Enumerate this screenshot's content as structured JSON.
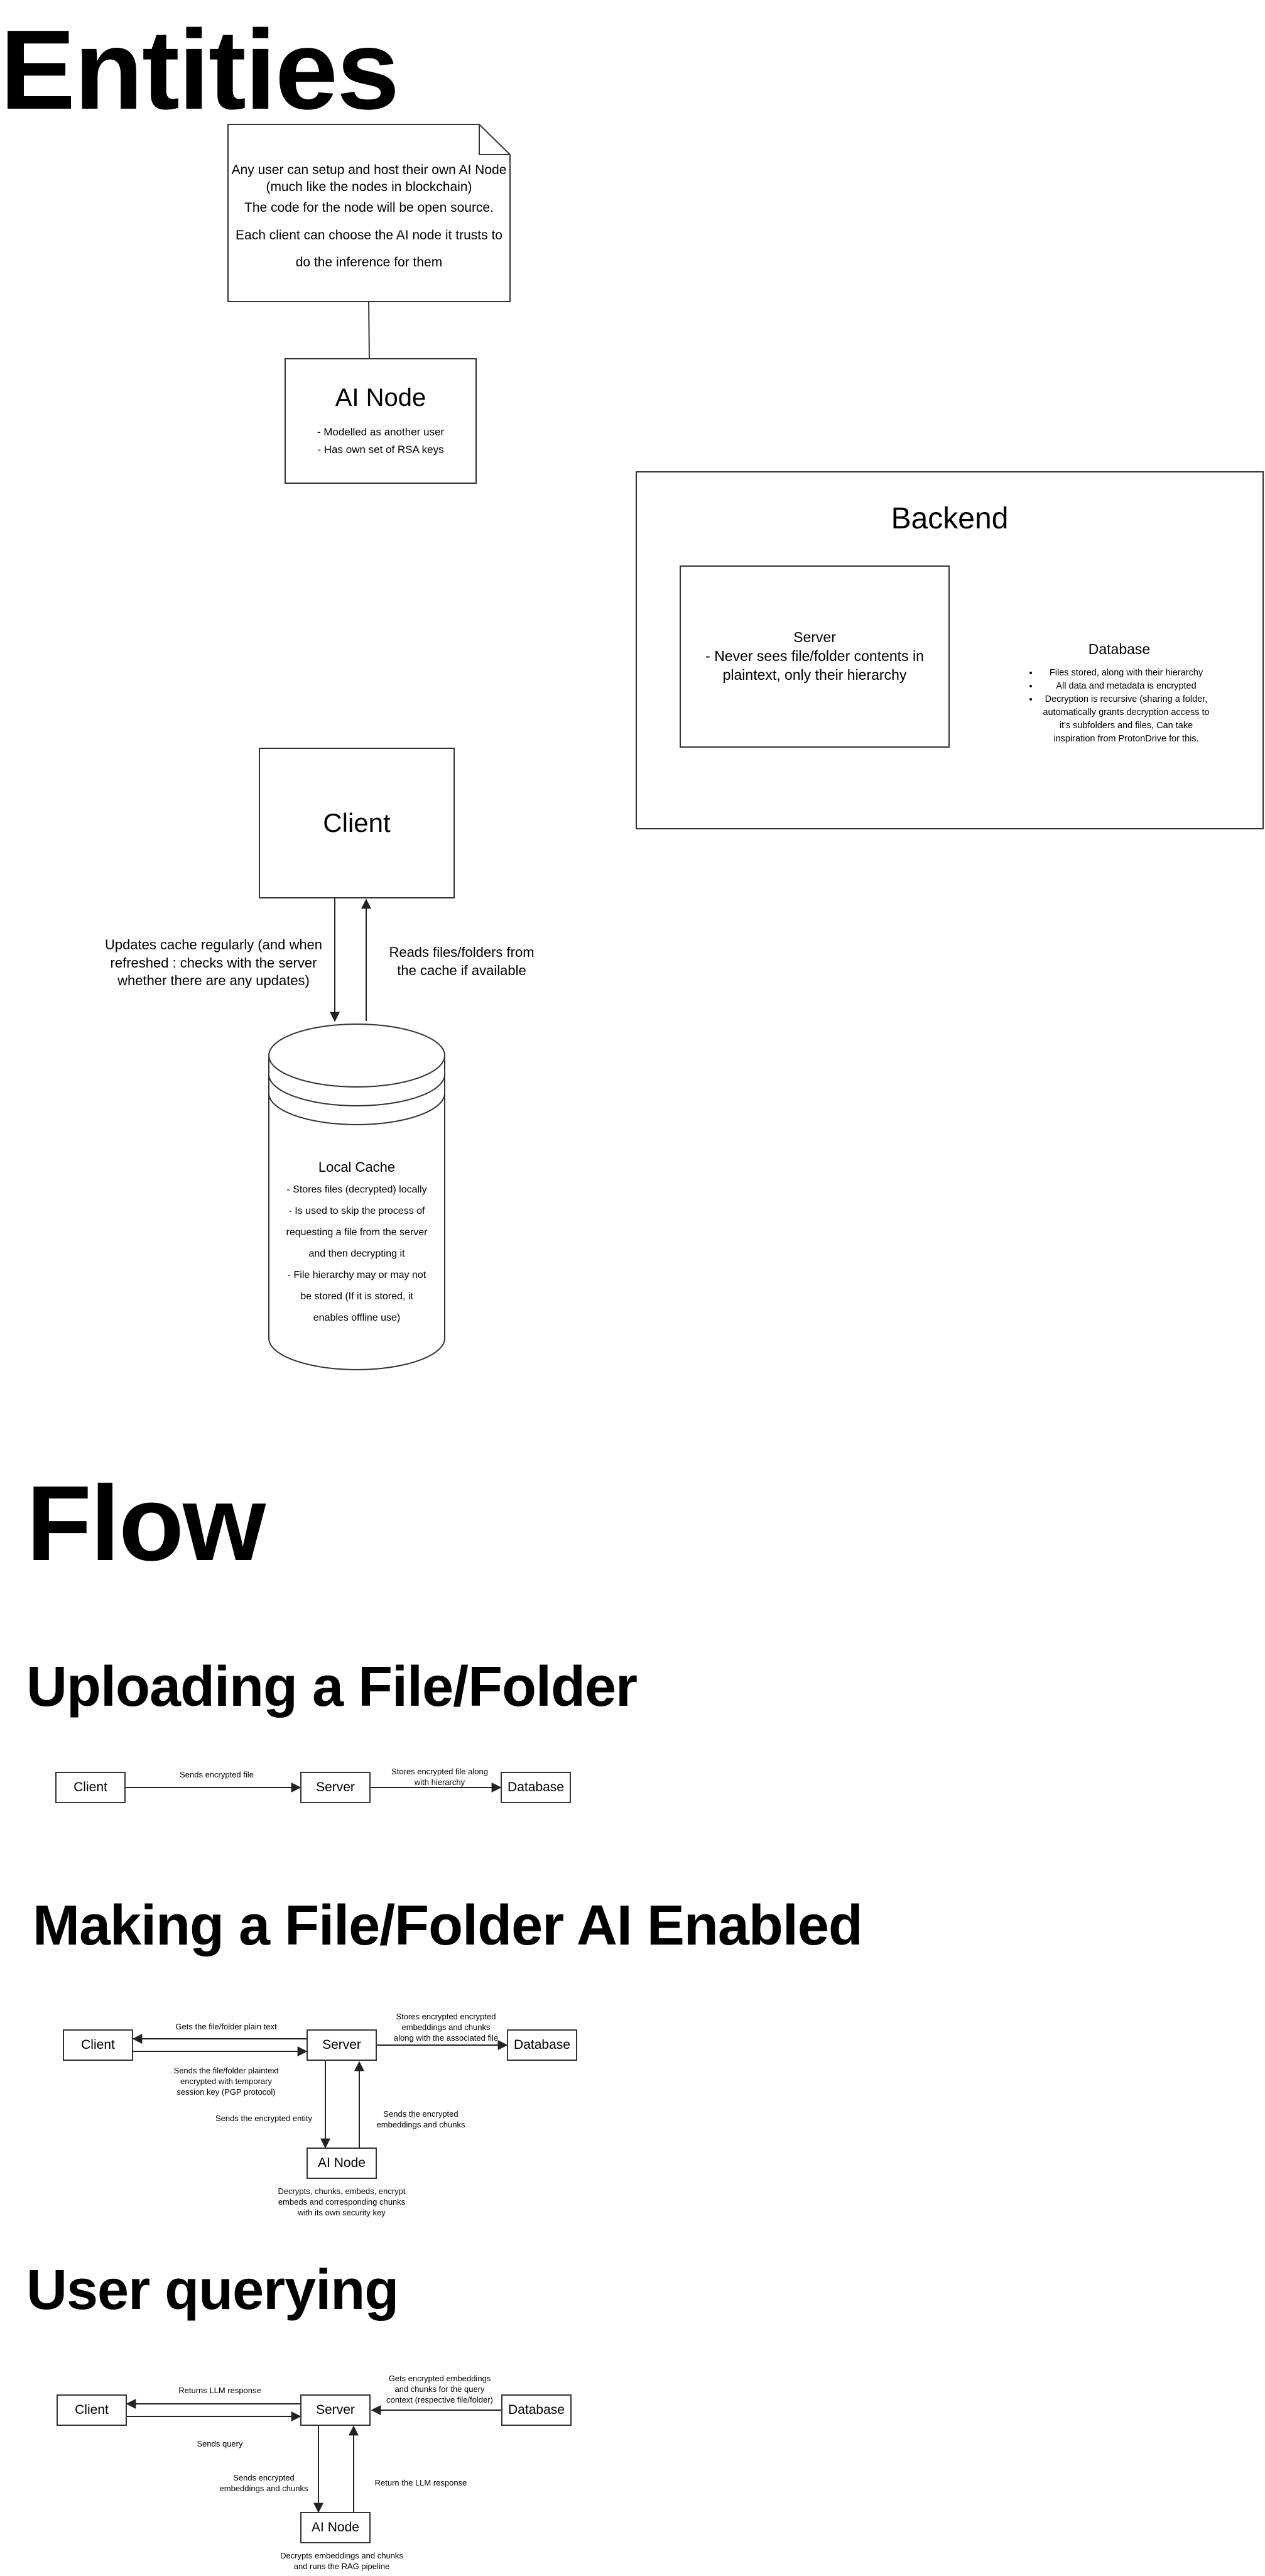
{
  "headings": {
    "entities": "Entities",
    "flow": "Flow",
    "upload": "Uploading a File/Folder",
    "ai_enabled": "Making a File/Folder AI Enabled",
    "querying": "User querying"
  },
  "note": {
    "line1": "Any user can setup and host their own AI Node",
    "line2": "(much like the nodes in blockchain)",
    "line3": "The code for the node will be open source.",
    "line4": "Each client can choose the AI node it trusts to",
    "line5": "do the inference for them"
  },
  "ai_node_entity": {
    "title": "AI Node",
    "line1": "- Modelled as another user",
    "line2": "- Has own set of RSA keys"
  },
  "backend": {
    "title": "Backend",
    "server_title": "Server",
    "server_line1": "- Never sees file/folder contents in",
    "server_line2": "plaintext, only their hierarchy",
    "db_title": "Database",
    "db_bullets": [
      "Files stored, along with their hierarchy",
      "All data and metadata is encrypted",
      "Decryption is recursive (sharing a folder, automatically grants decryption  access to it's subfolders and files, Can take inspiration from ProtonDrive for this."
    ]
  },
  "client_entity": {
    "title": "Client",
    "left_label_1": "Updates cache regularly (and when",
    "left_label_2": "refreshed : checks with the server",
    "left_label_3": "whether there are any updates)",
    "right_label_1": "Reads files/folders from",
    "right_label_2": "the cache if available"
  },
  "cache": {
    "title": "Local Cache",
    "lines": [
      "- Stores files (decrypted) locally",
      "- Is used to skip the process of",
      "requesting a file from the server",
      "and then decrypting it",
      "- File hierarchy may or may not",
      "be stored (If it is stored, it",
      "enables offline use)"
    ]
  },
  "upload_flow": {
    "client": "Client",
    "server": "Server",
    "database": "Database",
    "client_to_server": "Sends encrypted file",
    "server_to_db_1": "Stores encrypted file along",
    "server_to_db_2": "with hierarchy"
  },
  "ai_flow": {
    "client": "Client",
    "server": "Server",
    "database": "Database",
    "ai_node": "AI Node",
    "server_to_client": "Gets the file/folder plain text",
    "client_to_server_1": "Sends the file/folder plaintext",
    "client_to_server_2": "encrypted with temporary",
    "client_to_server_3": "session key (PGP protocol)",
    "server_to_db_1": "Stores encrypted encrypted",
    "server_to_db_2": "embeddings and chunks",
    "server_to_db_3": "along with the associated file",
    "server_to_ai": "Sends the encrypted entity",
    "ai_to_server_1": "Sends the encrypted",
    "ai_to_server_2": "embeddings and chunks",
    "ai_note_1": "Decrypts, chunks, embeds, encrypt",
    "ai_note_2": "embeds and corresponding chunks",
    "ai_note_3": "with its own security key"
  },
  "query_flow": {
    "client": "Client",
    "server": "Server",
    "database": "Database",
    "ai_node": "AI Node",
    "server_to_client": "Returns LLM response",
    "client_to_server": "Sends query",
    "db_to_server_1": "Gets encrypted embeddings",
    "db_to_server_2": "and chunks for the query",
    "db_to_server_3": "context (respective file/folder)",
    "server_to_ai_1": "Sends encrypted",
    "server_to_ai_2": "embeddings and chunks",
    "ai_to_server": "Return the LLM response",
    "ai_note_1": "Decrypts embeddings and chunks",
    "ai_note_2": "and runs the RAG pipeline"
  }
}
